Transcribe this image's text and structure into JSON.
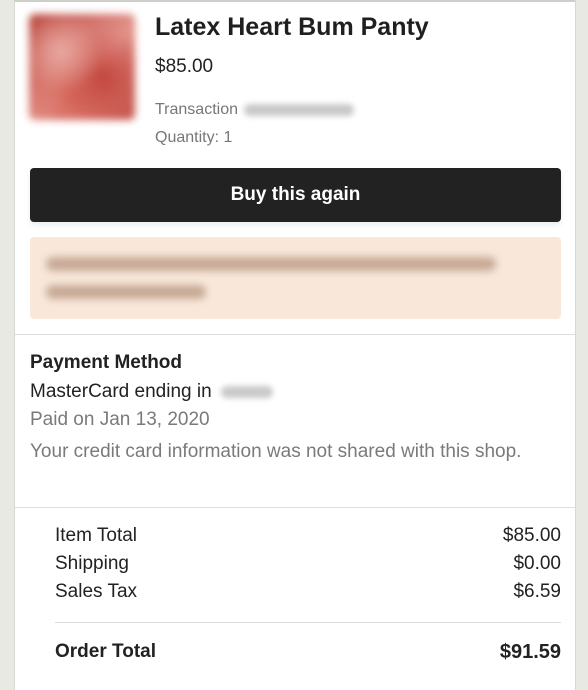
{
  "product": {
    "title": "Latex Heart Bum Panty",
    "price": "$85.00",
    "transaction_label": "Transaction",
    "quantity_label": "Quantity: 1"
  },
  "actions": {
    "buy_again_label": "Buy this again"
  },
  "payment": {
    "heading": "Payment Method",
    "card_label": "MasterCard ending in",
    "paid_on": "Paid on Jan 13, 2020",
    "note": "Your credit card information was not shared with this shop."
  },
  "totals": {
    "rows": [
      {
        "label": "Item Total",
        "value": "$85.00"
      },
      {
        "label": "Shipping",
        "value": "$0.00"
      },
      {
        "label": "Sales Tax",
        "value": "$6.59"
      }
    ],
    "order_total_label": "Order Total",
    "order_total_value": "$91.59"
  },
  "colors": {
    "button_bg": "#222222",
    "notice_bg": "#f9e8da",
    "muted_text": "#7a7a7a"
  }
}
